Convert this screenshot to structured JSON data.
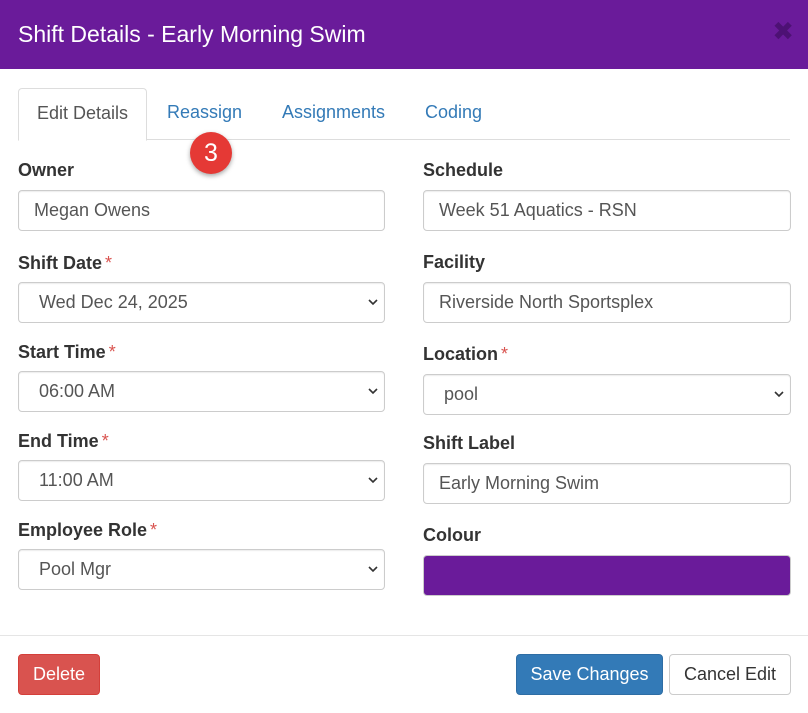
{
  "modal": {
    "title": "Shift Details - Early Morning Swim",
    "close_glyph": "✖",
    "header_color": "#6a1b9a"
  },
  "tabs": [
    {
      "label": "Edit Details",
      "active": true
    },
    {
      "label": "Reassign",
      "active": false
    },
    {
      "label": "Assignments",
      "active": false
    },
    {
      "label": "Coding",
      "active": false
    }
  ],
  "reassign_badge": "3",
  "left_column": {
    "owner": {
      "label": "Owner",
      "value": "Megan Owens"
    },
    "shift_date": {
      "label": "Shift Date",
      "value": "Wed Dec 24, 2025",
      "required": "*"
    },
    "start_time": {
      "label": "Start Time",
      "value": "06:00 AM",
      "required": "*"
    },
    "end_time": {
      "label": "End Time",
      "value": "11:00 AM",
      "required": "*"
    },
    "employee_role": {
      "label": "Employee Role",
      "value": "Pool Mgr",
      "required": "*"
    }
  },
  "right_column": {
    "schedule": {
      "label": "Schedule",
      "value": "Week 51 Aquatics - RSN"
    },
    "facility": {
      "label": "Facility",
      "value": "Riverside North Sportsplex"
    },
    "location": {
      "label": "Location",
      "value": "pool",
      "required": "*"
    },
    "shift_label": {
      "label": "Shift Label",
      "value": "Early Morning Swim"
    },
    "colour": {
      "label": "Colour",
      "value": "#6a1b9a"
    }
  },
  "footer": {
    "delete_label": "Delete",
    "save_label": "Save Changes",
    "cancel_label": "Cancel Edit"
  },
  "colors": {
    "primary": "#337ab7",
    "danger": "#d9534f",
    "badge": "#e53935"
  },
  "icons": {
    "dropdown": "chevron-down-icon",
    "close": "close-icon"
  }
}
